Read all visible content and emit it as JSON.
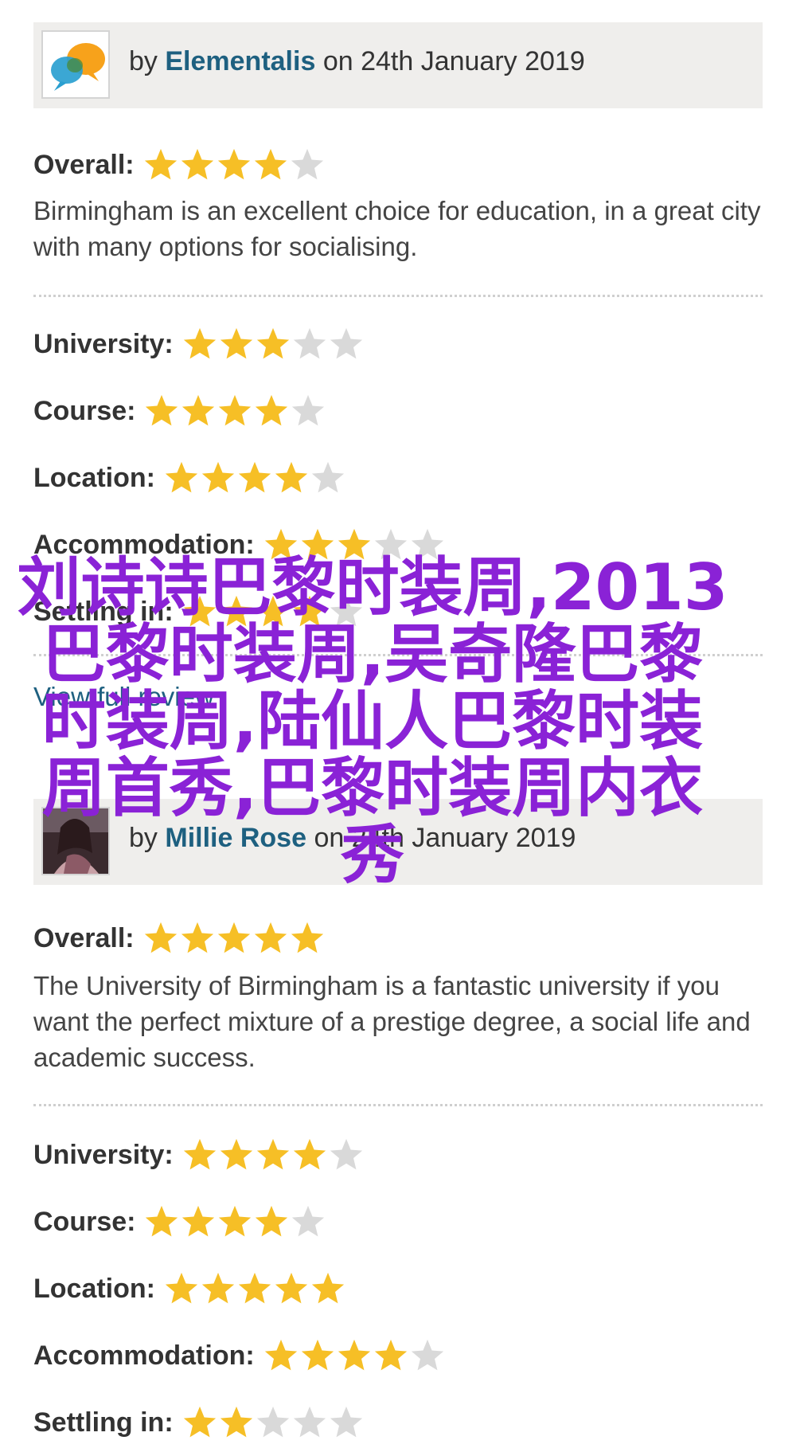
{
  "reviews": [
    {
      "by_prefix": "by",
      "author": "Elementalis",
      "date_text": "on 24th January 2019",
      "avatar_icon": "speech-bubbles-icon",
      "overall_label": "Overall:",
      "overall_stars": 4,
      "comment": "Birmingham is an excellent choice for education, in a great city with many options for socialising.",
      "ratings": [
        {
          "label": "University:",
          "stars": 3
        },
        {
          "label": "Course:",
          "stars": 4
        },
        {
          "label": "Location:",
          "stars": 4
        },
        {
          "label": "Accommodation:",
          "stars": 3
        },
        {
          "label": "Settling in:",
          "stars": 4
        }
      ],
      "view_link": "View full review"
    },
    {
      "by_prefix": "by",
      "author": "Millie Rose",
      "date_text": "on 24th January 2019",
      "avatar_icon": "user-photo-icon",
      "overall_label": "Overall:",
      "overall_stars": 5,
      "comment": "The University of Birmingham is a fantastic university if you want the perfect mixture of a prestige degree, a social life and academic success.",
      "ratings": [
        {
          "label": "University:",
          "stars": 4
        },
        {
          "label": "Course:",
          "stars": 4
        },
        {
          "label": "Location:",
          "stars": 5
        },
        {
          "label": "Accommodation:",
          "stars": 4
        },
        {
          "label": "Settling in:",
          "stars": 2
        }
      ]
    }
  ],
  "overlay_text": "刘诗诗巴黎时装周,2013巴黎时装周,吴奇隆巴黎时装周,陆仙人巴黎时装周首秀,巴黎时装周内衣秀",
  "colors": {
    "star_filled": "#f6bf26",
    "star_empty": "#d9d9d9",
    "author_link": "#1e6080",
    "header_bg": "#efeeec",
    "overlay_text": "#8a22d6"
  }
}
